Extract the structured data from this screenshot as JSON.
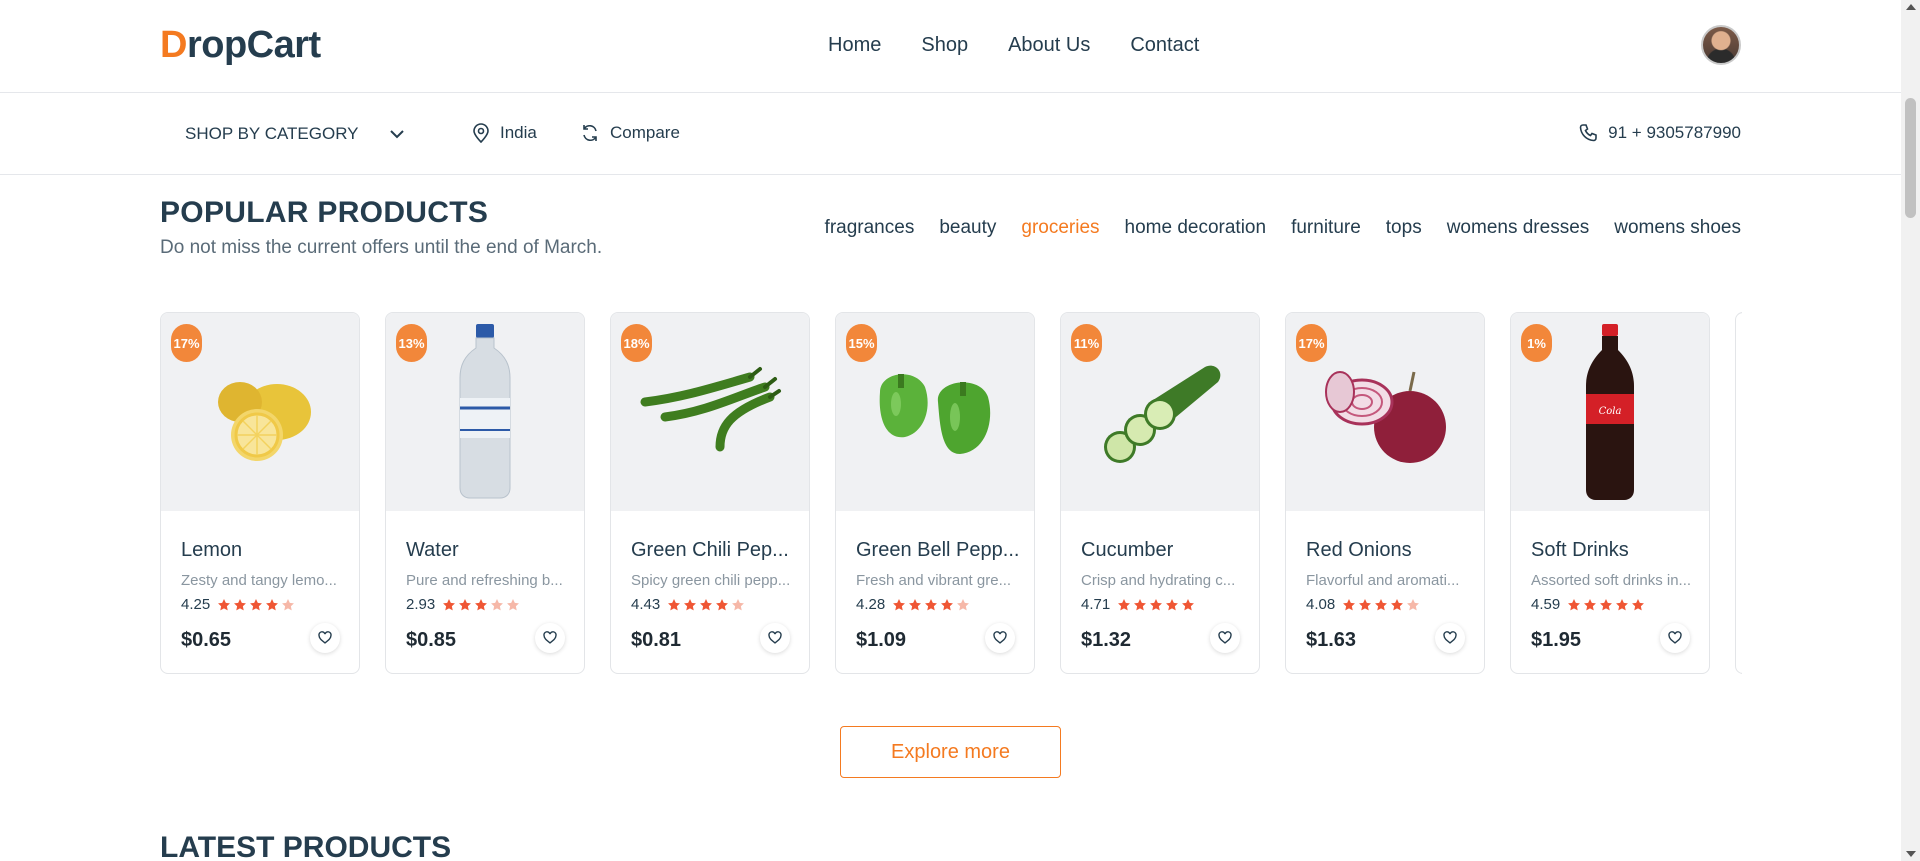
{
  "header": {
    "logo_first": "D",
    "logo_rest": "ropCart",
    "nav": [
      "Home",
      "Shop",
      "About Us",
      "Contact"
    ]
  },
  "subbar": {
    "category_label": "SHOP BY CATEGORY",
    "location": "India",
    "compare": "Compare",
    "phone": "91 + 9305787990"
  },
  "section": {
    "title": "POPULAR PRODUCTS",
    "subtitle": "Do not miss the current offers until the end of March.",
    "filters": [
      "fragrances",
      "beauty",
      "groceries",
      "home decoration",
      "furniture",
      "tops",
      "womens dresses",
      "womens shoes"
    ],
    "active_filter": "groceries"
  },
  "products": [
    {
      "discount": "17%",
      "name": "Lemon",
      "desc": "Zesty and tangy lemo...",
      "rating": "4.25",
      "stars": 4.25,
      "price": "$0.65",
      "image": "lemon"
    },
    {
      "discount": "13%",
      "name": "Water",
      "desc": "Pure and refreshing b...",
      "rating": "2.93",
      "stars": 2.93,
      "price": "$0.85",
      "image": "water-bottle"
    },
    {
      "discount": "18%",
      "name": "Green Chili Pep...",
      "desc": "Spicy green chili pepp...",
      "rating": "4.43",
      "stars": 4.43,
      "price": "$0.81",
      "image": "chili-pepper"
    },
    {
      "discount": "15%",
      "name": "Green Bell Pepp...",
      "desc": "Fresh and vibrant gre...",
      "rating": "4.28",
      "stars": 4.28,
      "price": "$1.09",
      "image": "bell-pepper"
    },
    {
      "discount": "11%",
      "name": "Cucumber",
      "desc": "Crisp and hydrating c...",
      "rating": "4.71",
      "stars": 4.71,
      "price": "$1.32",
      "image": "cucumber"
    },
    {
      "discount": "17%",
      "name": "Red Onions",
      "desc": "Flavorful and aromati...",
      "rating": "4.08",
      "stars": 4.08,
      "price": "$1.63",
      "image": "red-onion"
    },
    {
      "discount": "1%",
      "name": "Soft Drinks",
      "desc": "Assorted soft drinks in...",
      "rating": "4.59",
      "stars": 4.59,
      "price": "$1.95",
      "image": "soda-bottle"
    }
  ],
  "explore_label": "Explore more",
  "latest_title": "LATEST PRODUCTS",
  "colors": {
    "accent": "#f47a20",
    "badge": "#f2873a",
    "star": "#ef5634",
    "star_empty": "#f6b8a8",
    "text": "#253d4e"
  }
}
